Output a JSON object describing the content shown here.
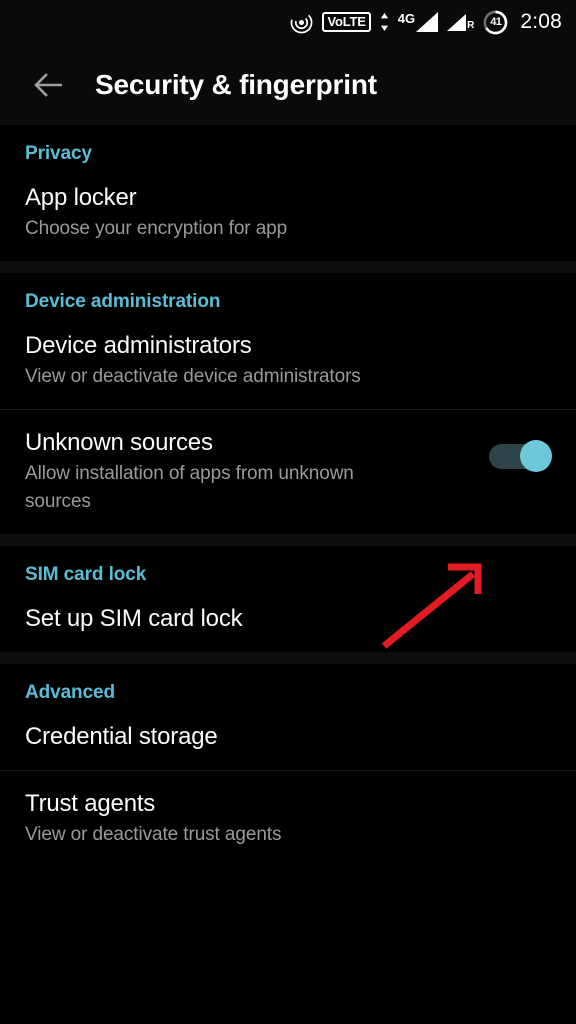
{
  "status_bar": {
    "icons": [
      {
        "name": "vowifi-icon",
        "label": ""
      },
      {
        "name": "volte-icon",
        "label": "VoLTE"
      },
      {
        "name": "data-transfer-icon",
        "label": ""
      },
      {
        "name": "signal-4g-icon",
        "label": "4G"
      },
      {
        "name": "signal-roaming-icon",
        "label": "R"
      },
      {
        "name": "battery-icon",
        "label": "41"
      }
    ],
    "volte_label": "VoLTE",
    "network_label": "4G",
    "roaming_label": "R",
    "battery_level": "41",
    "clock": "2:08"
  },
  "toolbar": {
    "back_label": "Back",
    "title": "Security & fingerprint"
  },
  "colors": {
    "accent_cyan": "#59bdd6",
    "toggle_thumb": "#6ec8db",
    "toggle_track": "#2d4449",
    "annotation_red": "#e31b23",
    "background": "#000000",
    "toolbar_background": "#0a0a0a",
    "title_text": "#ffffff",
    "subtitle_text": "#9a9a9a"
  },
  "sections": [
    {
      "header": "Privacy",
      "rows": [
        {
          "title": "App locker",
          "subtitle": "Choose your encryption for app",
          "has_toggle": false
        }
      ]
    },
    {
      "header": "Device administration",
      "rows": [
        {
          "title": "Device administrators",
          "subtitle": "View or deactivate device administrators",
          "has_toggle": false
        },
        {
          "title": "Unknown sources",
          "subtitle": "Allow installation of apps from unknown sources",
          "has_toggle": true,
          "toggle_state": "on"
        }
      ]
    },
    {
      "header": "SIM card lock",
      "rows": [
        {
          "title": "Set up SIM card lock",
          "subtitle": "",
          "has_toggle": false
        }
      ]
    },
    {
      "header": "Advanced",
      "rows": [
        {
          "title": "Credential storage",
          "subtitle": "",
          "has_toggle": false
        },
        {
          "title": "Trust agents",
          "subtitle": "View or deactivate trust agents",
          "has_toggle": false
        }
      ]
    }
  ],
  "annotation": {
    "type": "arrow",
    "points_to": "unknown-sources-toggle",
    "color": "#e31b23"
  }
}
